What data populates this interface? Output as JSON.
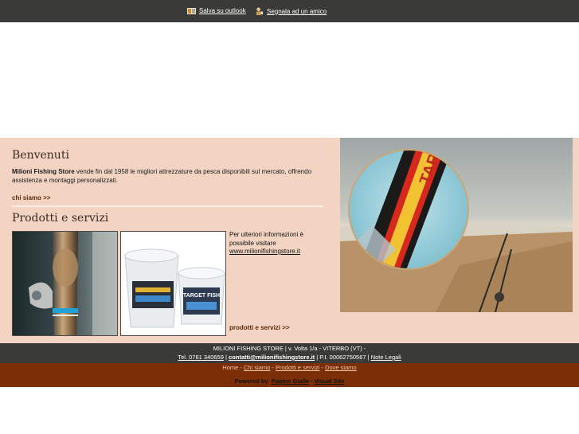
{
  "header": {
    "save_outlook": "Salva su outlook",
    "report_friend": "Segnala ad un amico"
  },
  "welcome": {
    "title": "Benvenuti",
    "brand": "Milioni Fishing Store",
    "text": " vende fin dal 1958 le migliori attrezzature da pesca disponibili sul mercato, offrendo assistenza e montaggi personalizzati.",
    "more_link": "chi siamo >>"
  },
  "products": {
    "title": "Prodotti e servizi",
    "info_text": "Per ulteriori informazioni è possibile visitare",
    "website": "www.milionifishingstore.it",
    "more_link": "prodotti e servizi >>",
    "bucket_label": "TARGET FISH"
  },
  "hero": {
    "rod_text": "TARGET"
  },
  "footer": {
    "company_line": "MILIONI FISHING STORE | v. Volta 1/a - VITERBO (VT) -",
    "phone": "Tel. 0761 340659",
    "sep1": " | ",
    "email": "contatti@milionifishingstore.it",
    "vat": " | P.I. 00062750567 | ",
    "legal": "Note Legali",
    "nav": {
      "home": "Home",
      "sep": " - ",
      "about": "Chi siamo",
      "products": "Prodotti e servizi",
      "where": "Dove siamo"
    },
    "powered_by": "Powered by",
    "pagine_gialle": "Pagine Gialle",
    "dash": " - ",
    "visual_site": "Visual Site"
  }
}
